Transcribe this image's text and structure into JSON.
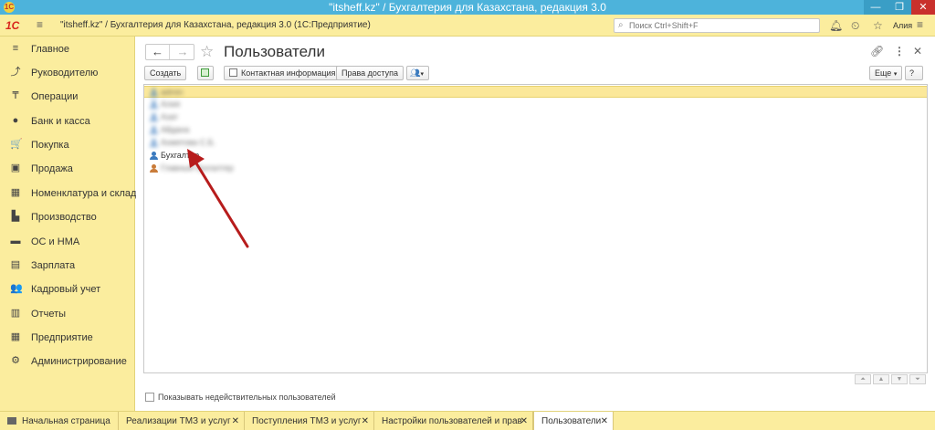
{
  "window": {
    "title": "\"itsheff.kz\" / Бухгалтерия для Казахстана, редакция 3.0",
    "min": "—",
    "max": "❐",
    "close": "✕"
  },
  "appbar": {
    "crumb": "\"itsheff.kz\" / Бухгалтерия для Казахстана, редакция 3.0  (1С:Предприятие)",
    "search_placeholder": "Поиск Ctrl+Shift+F",
    "user": "Алия"
  },
  "sidebar": {
    "items": [
      {
        "label": "Главное",
        "icon": "≡"
      },
      {
        "label": "Руководителю",
        "icon": "⤴"
      },
      {
        "label": "Операции",
        "icon": "₸"
      },
      {
        "label": "Банк и касса",
        "icon": "●"
      },
      {
        "label": "Покупка",
        "icon": "🛒"
      },
      {
        "label": "Продажа",
        "icon": "▣"
      },
      {
        "label": "Номенклатура и склад",
        "icon": "▦"
      },
      {
        "label": "Производство",
        "icon": "▙"
      },
      {
        "label": "ОС и НМА",
        "icon": "▬"
      },
      {
        "label": "Зарплата",
        "icon": "▤"
      },
      {
        "label": "Кадровый учет",
        "icon": "👥"
      },
      {
        "label": "Отчеты",
        "icon": "▥"
      },
      {
        "label": "Предприятие",
        "icon": "▦"
      },
      {
        "label": "Администрирование",
        "icon": "⚙"
      }
    ]
  },
  "page": {
    "title": "Пользователи",
    "more_label": "Еще"
  },
  "toolbar": {
    "create": "Создать",
    "contact_info": "Контактная информация",
    "access_rights": "Права доступа"
  },
  "users": {
    "rows": [
      {
        "label": "admin",
        "blurred": true,
        "selected": true
      },
      {
        "label": "Алия",
        "blurred": true,
        "selected": false
      },
      {
        "label": "Азат",
        "blurred": true,
        "selected": false
      },
      {
        "label": "Айдана",
        "blurred": true,
        "selected": false
      },
      {
        "label": "Ахметова С.Б.",
        "blurred": true,
        "selected": false
      },
      {
        "label": "Бухгалтер",
        "blurred": false,
        "selected": false
      },
      {
        "label": "Главный бухгалтер",
        "blurred": true,
        "selected": false
      }
    ]
  },
  "footer": {
    "show_inactive": "Показывать недействительных пользователей"
  },
  "tabs": [
    {
      "label": "Начальная страница",
      "closable": false,
      "active": false
    },
    {
      "label": "Реализации ТМЗ и услуг",
      "closable": true,
      "active": false
    },
    {
      "label": "Поступления ТМЗ и услуг",
      "closable": true,
      "active": false
    },
    {
      "label": "Настройки пользователей и прав",
      "closable": true,
      "active": false
    },
    {
      "label": "Пользователи",
      "closable": true,
      "active": true
    }
  ],
  "colors": {
    "accent_yellow": "#fbed9e",
    "titlebar_blue": "#4db3db",
    "annotation_red": "#b71c1c"
  }
}
